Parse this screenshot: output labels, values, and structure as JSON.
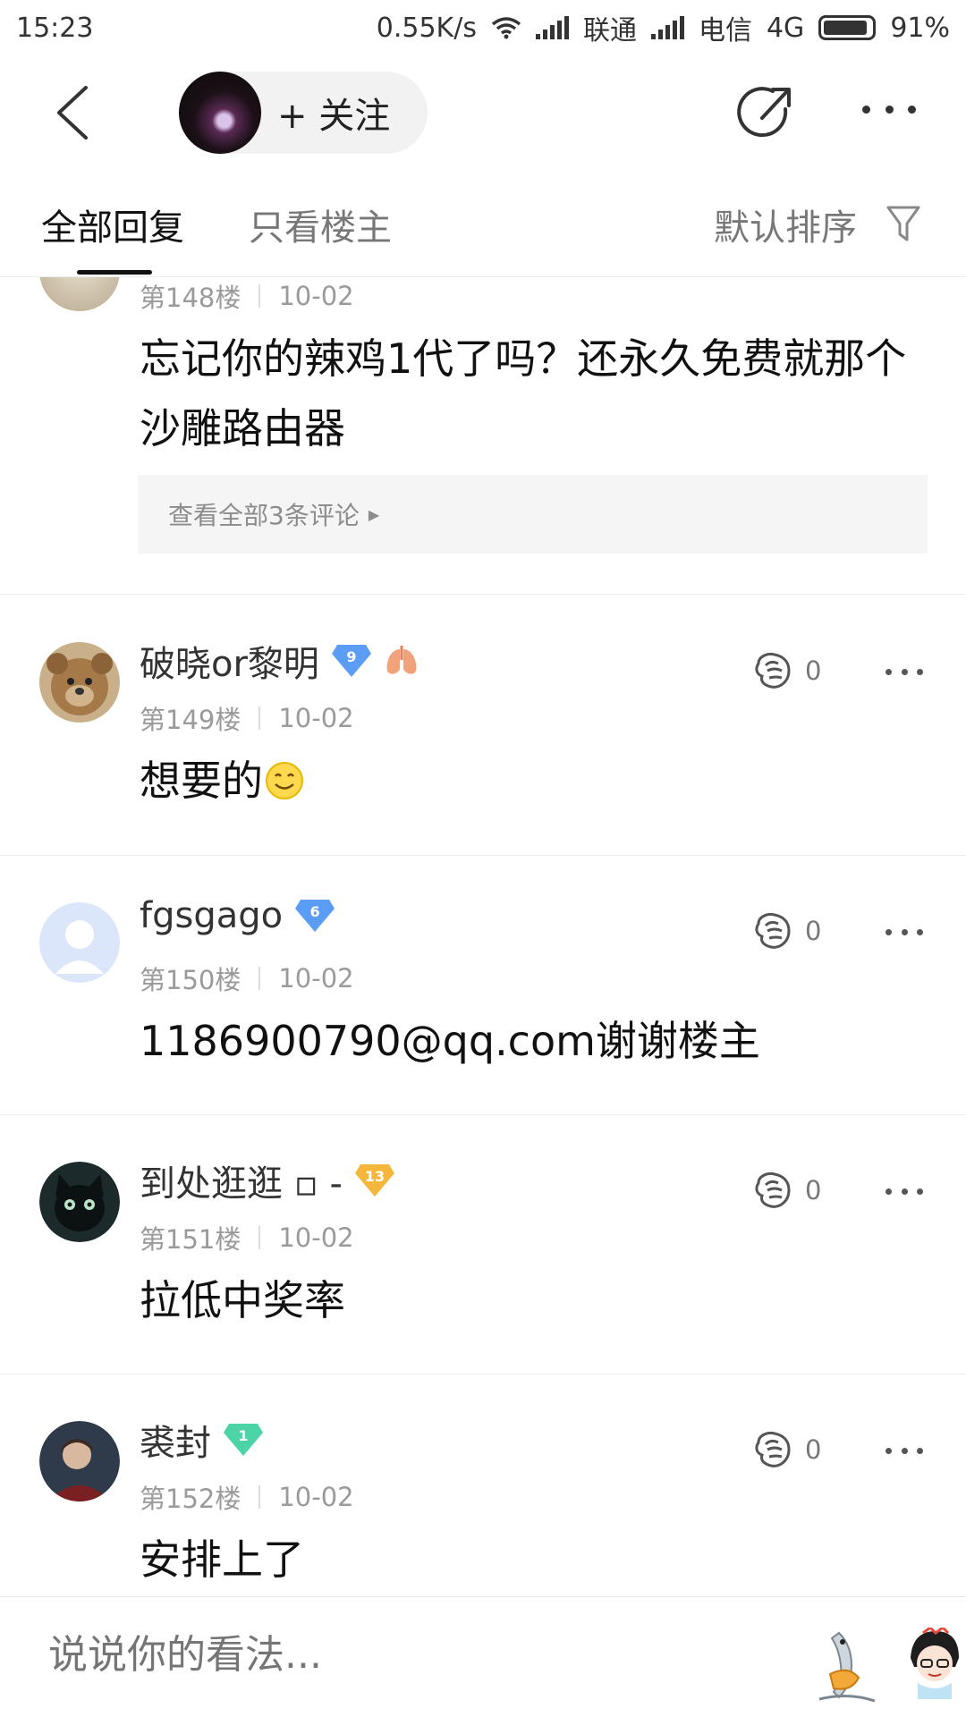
{
  "status_bar": {
    "time": "15:23",
    "network_speed": "0.55K/s",
    "carrier1": "联通",
    "carrier2": "电信",
    "network_type": "4G",
    "battery": "91%",
    "battery_level": 0.91
  },
  "nav": {
    "follow_label": "+ 关注",
    "icons": [
      "back-arrow-icon",
      "share-icon",
      "more-icon"
    ]
  },
  "tabs": {
    "all_replies": "全部回复",
    "op_only": "只看楼主",
    "sort": "默认排序"
  },
  "partial_reply": {
    "floor": "第148楼",
    "date": "10-02",
    "text": "忘记你的辣鸡1代了吗？还永久免费就那个沙雕路由器",
    "more_comments": "查看全部3条评论"
  },
  "replies": [
    {
      "username": "破晓or黎明",
      "level": "9",
      "badge_color": "#5b9df5",
      "floor": "第149楼",
      "date": "10-02",
      "likes": "0",
      "text": "想要的"
    },
    {
      "username": "fgsgago",
      "level": "6",
      "badge_color": "#5b9df5",
      "floor": "第150楼",
      "date": "10-02",
      "likes": "0",
      "text": "1186900790@qq.com谢谢楼主"
    },
    {
      "username": "到处逛逛 ▫ -",
      "level": "13",
      "badge_color": "#f5b73b",
      "floor": "第151楼",
      "date": "10-02",
      "likes": "0",
      "text": "拉低中奖率"
    },
    {
      "username": "裘封",
      "level": "1",
      "badge_color": "#4dd4a6",
      "floor": "第152楼",
      "date": "10-02",
      "likes": "0",
      "text": "安排上了"
    }
  ],
  "bottom": {
    "input_placeholder": "说说你的看法..."
  }
}
